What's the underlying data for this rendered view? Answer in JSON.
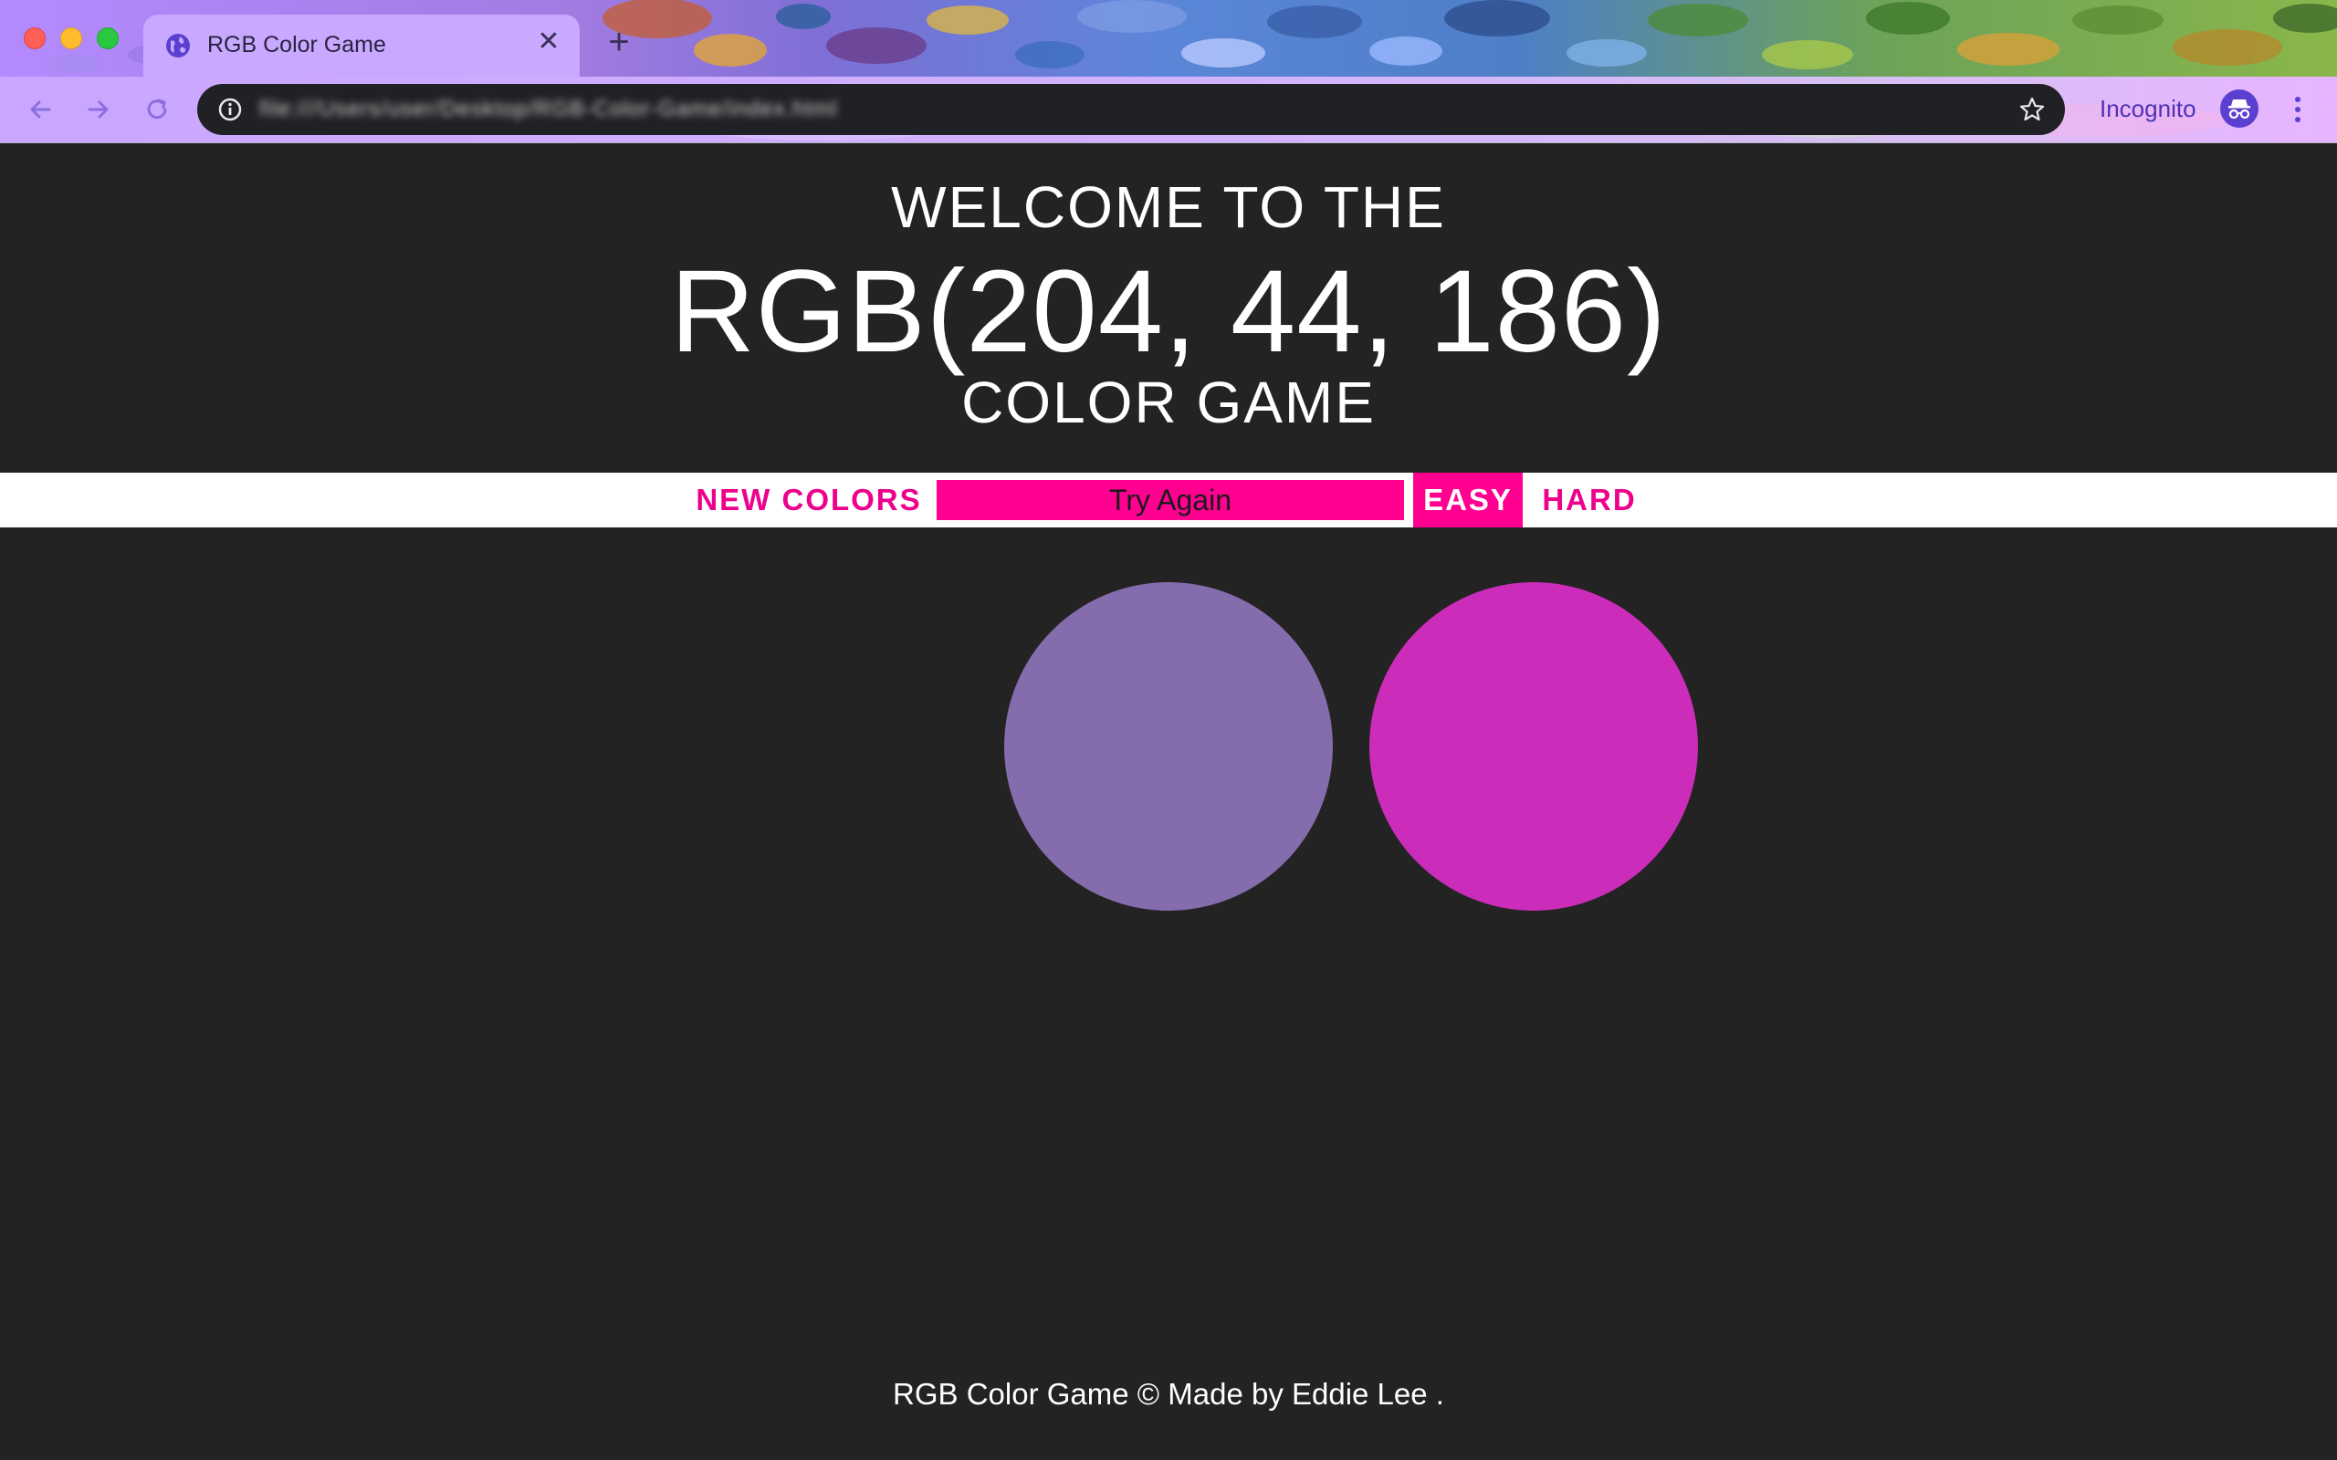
{
  "browser": {
    "tab_title": "RGB Color Game",
    "tab_close_glyph": "✕",
    "new_tab_glyph": "+",
    "url": "file:///Users/user/Desktop/RGB-Color-Game/index.html",
    "incognito_label": "Incognito",
    "icons": {
      "favicon": "globe-icon",
      "back": "arrow-left-icon",
      "forward": "arrow-right-icon",
      "reload": "reload-icon",
      "info": "info-icon",
      "bookmark": "star-icon",
      "incognito": "incognito-icon",
      "menu": "kebab-menu-icon"
    },
    "colors": {
      "accent": "#4a33b8",
      "omnibox": "#202124",
      "close": "#fe5f57",
      "minimize": "#febc2e",
      "zoom": "#28c840"
    }
  },
  "header": {
    "line1": "WELCOME TO THE",
    "rgb_target": "RGB(204, 44, 186)",
    "line3": "COLOR GAME"
  },
  "stripe": {
    "new_colors": "NEW COLORS",
    "message": "Try Again",
    "easy": "EASY",
    "hard": "HARD",
    "selected_mode": "EASY"
  },
  "squares": [
    {
      "color": "#856cad"
    },
    {
      "color": "#cc2cba"
    }
  ],
  "footer": {
    "text": "RGB Color Game © Made by Eddie Lee ."
  },
  "colors": {
    "background": "#232323",
    "accent_pink": "#ff0090",
    "pink_text": "#ec008c",
    "white": "#ffffff"
  }
}
